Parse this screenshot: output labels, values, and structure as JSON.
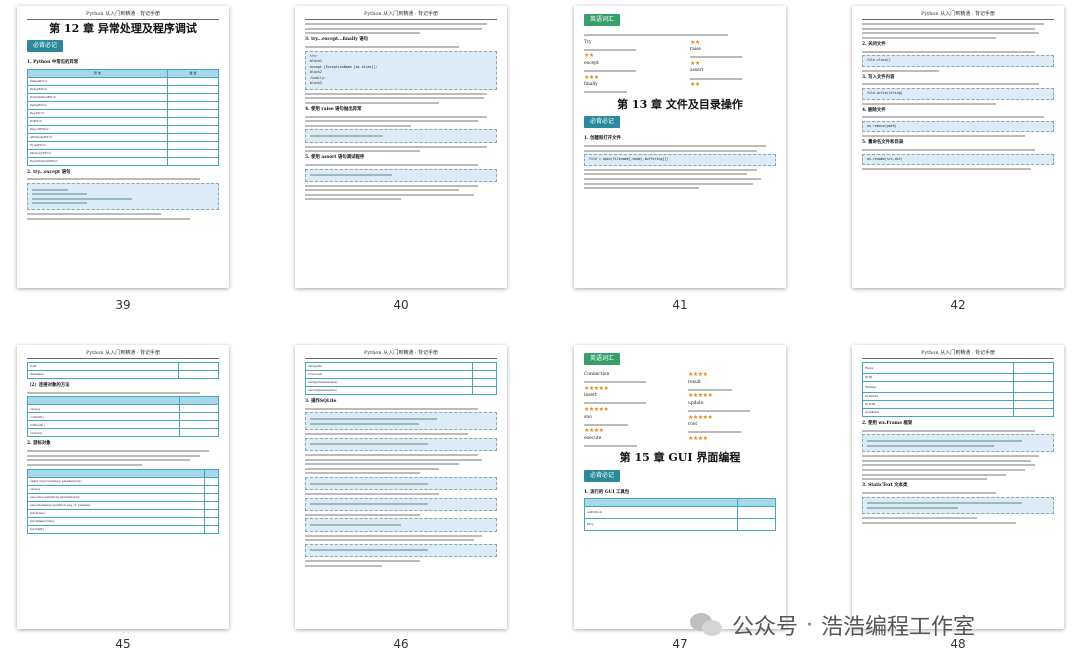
{
  "header_text": "Python 从入门到精通 · 背记手册",
  "page_numbers": [
    "39",
    "40",
    "41",
    "42",
    "45",
    "46",
    "47",
    "48"
  ],
  "badges": {
    "memory": "必背必记",
    "vocab": "英语词汇"
  },
  "pages": {
    "p39": {
      "chapter_title": "第 12 章  异常处理及程序调试",
      "section_1": "1. Python 中常见的异常",
      "table_header": [
        "异 常",
        "描 述"
      ],
      "exceptions": [
        "NameError",
        "IndexError",
        "IndentationError",
        "ValueError",
        "KeyError",
        "IOError",
        "ImportError",
        "AttributeError",
        "TypeError",
        "MemoryError",
        "ZeroDivisionError"
      ],
      "section_2": "2. try...except 语句"
    },
    "p40": {
      "section_3": "3. try...except...finally 语句",
      "section_4": "4. 使用 raise 语句抛出异常",
      "section_5": "5. 使用 assert 语句调试程序",
      "code_lines": [
        "try:",
        "    block1",
        "except [ExceptionName [as alias]]:",
        "    block2",
        "finally:",
        "    block3"
      ]
    },
    "p41": {
      "vocab_words": [
        "Try",
        "except",
        "finally",
        "raise",
        "assert"
      ],
      "chapter_title": "第 13 章  文件及目录操作",
      "section_1": "1. 创建和打开文件",
      "code": "file = open(filename[,mode[,buffering]])"
    },
    "p42": {
      "section_2": "2. 关闭文件",
      "section_3": "3. 写入文件内容",
      "section_4": "4. 删除文件",
      "section_5": "5. 重命名文件和目录",
      "code_close": "file.close()",
      "code_write": "file.write(string)",
      "code_remove": "os.remove(path)",
      "code_rename": "os.rename(src,dst)"
    },
    "p45": {
      "rows_top": [
        "host",
        "database"
      ],
      "section_conn": "（2）连接对象的方法",
      "methods": [
        "close()",
        "commit()",
        "rollback()",
        "cursor()"
      ],
      "section_cursor": "2. 游标对象",
      "cursor_methods": [
        "callproc(procname,[,parameters])",
        "close()",
        "execute(operation[,parameters])",
        "executemany(operation,seq_of_params)",
        "fetchone()",
        "fetchmany(size)",
        "fetchall()"
      ]
    },
    "p46": {
      "rows_top": [
        "arraysize",
        "rowcount",
        "setinputsizes(sizes)",
        "setoutputsize(size)"
      ],
      "section_3": "3. 操作SQLite"
    },
    "p47": {
      "vocab_words": [
        "Connection",
        "result",
        "insert",
        "update",
        "sno",
        "root",
        "execute"
      ],
      "chapter_title": "第 15 章  GUI 界面编程",
      "section_1": "1. 流行的 GUI 工具包",
      "table_rows": [
        "wxPython",
        "Kivy"
      ]
    },
    "p48": {
      "table_rows": [
        "Flexx",
        "PyQt",
        "Tkinter",
        "Pywin32",
        "PyGTK",
        "pyui4win"
      ],
      "section_2": "2. 使用 wx.Frame 框架",
      "section_3": "3. StaticText 文本类"
    }
  },
  "watermark": {
    "icon": "wechat-icon",
    "separator": "·",
    "text_left": "公众号",
    "text_right": "浩浩编程工作室"
  },
  "colors": {
    "badge_teal": "#2a8a9c",
    "badge_green": "#36a06b",
    "table_border": "#4aa6bd",
    "table_head": "#a5d8e8",
    "code_bg": "#dcebf5",
    "star": "#e08a1a"
  }
}
